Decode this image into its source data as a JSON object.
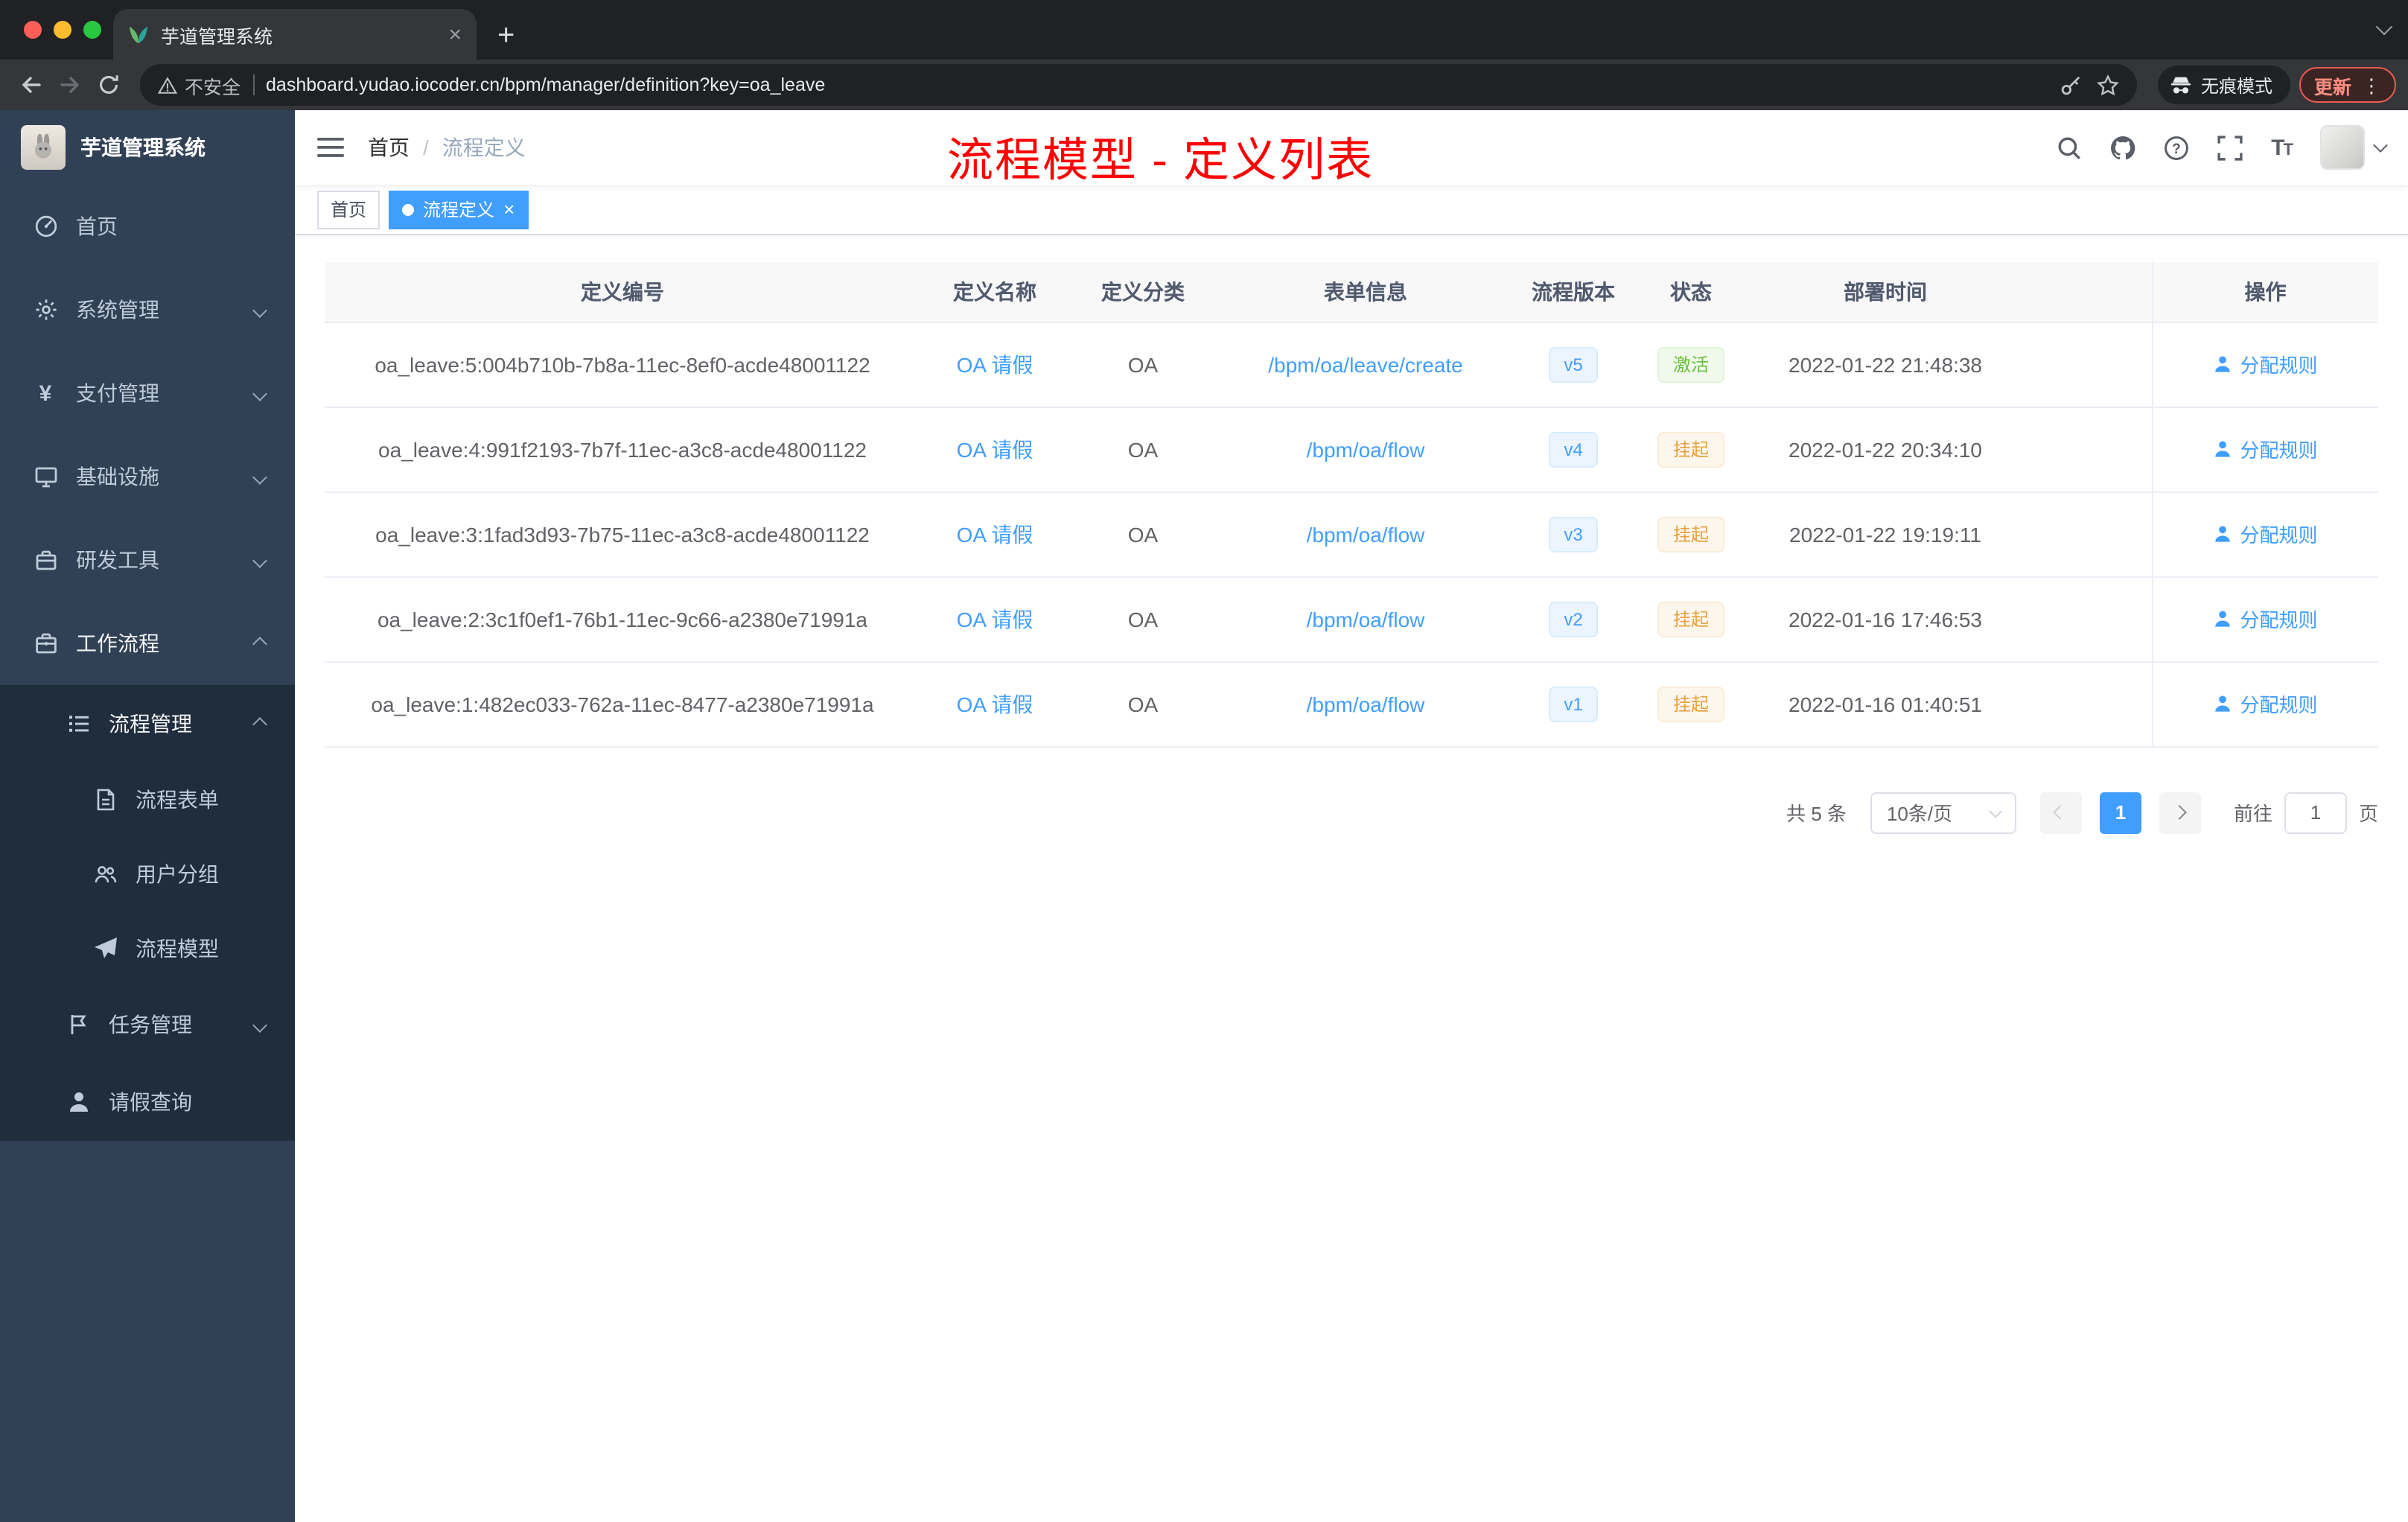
{
  "browser": {
    "tab_title": "芋道管理系统",
    "security_label": "不安全",
    "url": "dashboard.yudao.iocoder.cn/bpm/manager/definition?key=oa_leave",
    "incognito_label": "无痕模式",
    "update_label": "更新"
  },
  "sidebar": {
    "logo_title": "芋道管理系统",
    "items": [
      {
        "label": "首页"
      },
      {
        "label": "系统管理"
      },
      {
        "label": "支付管理"
      },
      {
        "label": "基础设施"
      },
      {
        "label": "研发工具"
      },
      {
        "label": "工作流程"
      }
    ],
    "submenu": {
      "process_mgmt": {
        "label": "流程管理"
      },
      "process_form": {
        "label": "流程表单"
      },
      "user_group": {
        "label": "用户分组"
      },
      "process_model": {
        "label": "流程模型"
      },
      "task_mgmt": {
        "label": "任务管理"
      },
      "leave_query": {
        "label": "请假查询"
      }
    }
  },
  "navbar": {
    "breadcrumb_home": "首页",
    "breadcrumb_sep": "/",
    "breadcrumb_current": "流程定义"
  },
  "annotation": "流程模型 - 定义列表",
  "tags": {
    "home": "首页",
    "current": "流程定义"
  },
  "table": {
    "headers": {
      "id": "定义编号",
      "name": "定义名称",
      "category": "定义分类",
      "form": "表单信息",
      "version": "流程版本",
      "status": "状态",
      "deploy_time": "部署时间",
      "action": "操作"
    },
    "action_label": "分配规则",
    "rows": [
      {
        "id": "oa_leave:5:004b710b-7b8a-11ec-8ef0-acde48001122",
        "name": "OA 请假",
        "category": "OA",
        "form": "/bpm/oa/leave/create",
        "version": "v5",
        "status": "激活",
        "deploy_time": "2022-01-22 21:48:38"
      },
      {
        "id": "oa_leave:4:991f2193-7b7f-11ec-a3c8-acde48001122",
        "name": "OA 请假",
        "category": "OA",
        "form": "/bpm/oa/flow",
        "version": "v4",
        "status": "挂起",
        "deploy_time": "2022-01-22 20:34:10"
      },
      {
        "id": "oa_leave:3:1fad3d93-7b75-11ec-a3c8-acde48001122",
        "name": "OA 请假",
        "category": "OA",
        "form": "/bpm/oa/flow",
        "version": "v3",
        "status": "挂起",
        "deploy_time": "2022-01-22 19:19:11"
      },
      {
        "id": "oa_leave:2:3c1f0ef1-76b1-11ec-9c66-a2380e71991a",
        "name": "OA 请假",
        "category": "OA",
        "form": "/bpm/oa/flow",
        "version": "v2",
        "status": "挂起",
        "deploy_time": "2022-01-16 17:46:53"
      },
      {
        "id": "oa_leave:1:482ec033-762a-11ec-8477-a2380e71991a",
        "name": "OA 请假",
        "category": "OA",
        "form": "/bpm/oa/flow",
        "version": "v1",
        "status": "挂起",
        "deploy_time": "2022-01-16 01:40:51"
      }
    ]
  },
  "pagination": {
    "total": "共 5 条",
    "page_size": "10条/页",
    "page": "1",
    "goto": "前往",
    "goto_value": "1",
    "unit": "页"
  }
}
